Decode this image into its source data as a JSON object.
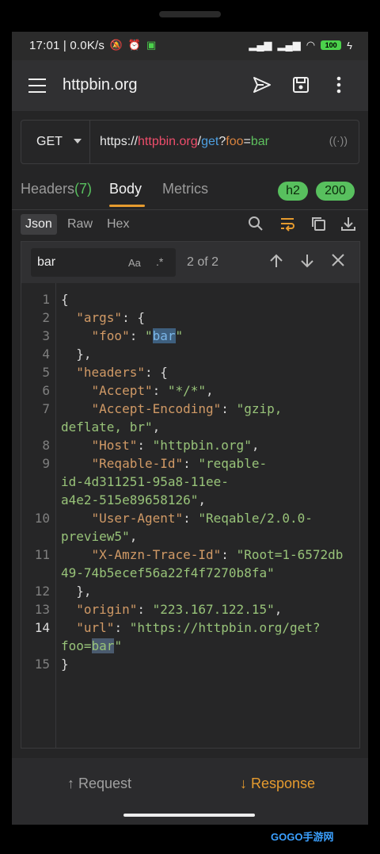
{
  "status": {
    "time": "17:01 | 0.0K/s",
    "battery": "100"
  },
  "appbar": {
    "title": "httpbin.org"
  },
  "url": {
    "method": "GET",
    "scheme": "https://",
    "host": "httpbin.org",
    "sep": "/",
    "path": "get",
    "q": "?",
    "key": "foo",
    "eq": "=",
    "val": "bar"
  },
  "tabs": {
    "headers": "Headers",
    "headers_count": "(7)",
    "body": "Body",
    "metrics": "Metrics",
    "protocol": "h2",
    "status_code": "200"
  },
  "subtabs": {
    "json": "Json",
    "raw": "Raw",
    "hex": "Hex"
  },
  "find": {
    "query": "bar",
    "case": "Aa",
    "regex": ".*",
    "count": "2 of 2"
  },
  "code_lines": [
    {
      "n": "1",
      "t": "{"
    },
    {
      "n": "2",
      "t": "  \"args\": {"
    },
    {
      "n": "3",
      "t": "    \"foo\": \"bar\""
    },
    {
      "n": "4",
      "t": "  },"
    },
    {
      "n": "5",
      "t": "  \"headers\": {"
    },
    {
      "n": "6",
      "t": "    \"Accept\": \"*/*\","
    },
    {
      "n": "7",
      "t": "    \"Accept-Encoding\": \"gzip, deflate, br\","
    },
    {
      "n": "8",
      "t": "    \"Host\": \"httpbin.org\","
    },
    {
      "n": "9",
      "t": "    \"Reqable-Id\": \"reqable-id-4d311251-95a8-11ee-a4e2-515e89658126\","
    },
    {
      "n": "10",
      "t": "    \"User-Agent\": \"Reqable/2.0.0-preview5\","
    },
    {
      "n": "11",
      "t": "    \"X-Amzn-Trace-Id\": \"Root=1-6572db49-74b5ecef56a22f4f7270b8fa\""
    },
    {
      "n": "12",
      "t": "  },"
    },
    {
      "n": "13",
      "t": "  \"origin\": \"223.167.122.15\","
    },
    {
      "n": "14",
      "t": "  \"url\": \"https://httpbin.org/get?foo=bar\""
    },
    {
      "n": "15",
      "t": "}"
    }
  ],
  "bottom": {
    "request": "↑ Request",
    "response": "↓ Response"
  },
  "watermark": "GOGO手游网",
  "colors": {
    "accent": "#e69b2e",
    "success": "#58c05e",
    "host": "#ee4d6b",
    "path": "#4d9fe0"
  }
}
